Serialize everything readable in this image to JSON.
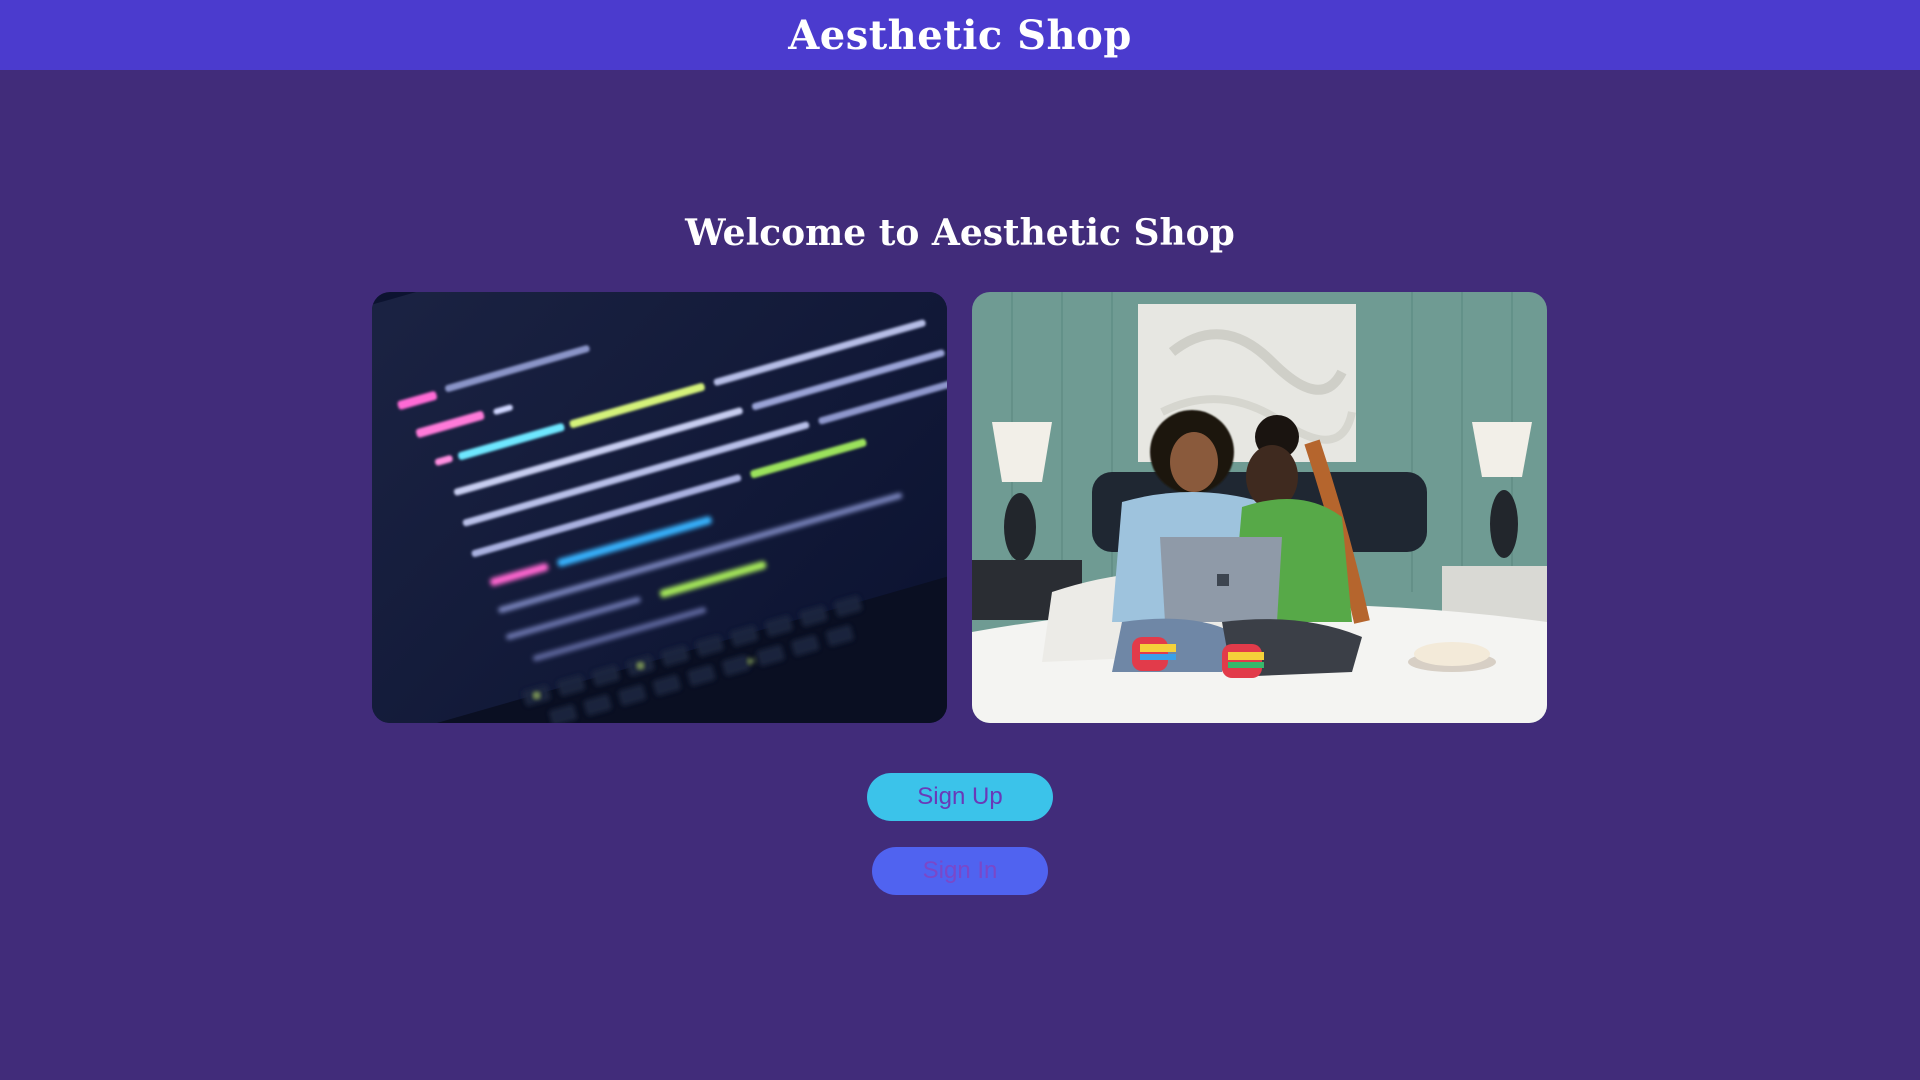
{
  "header": {
    "title": "Aesthetic Shop"
  },
  "main": {
    "welcome": "Welcome to Aesthetic Shop",
    "images": [
      {
        "subject": "code-on-laptop-screen"
      },
      {
        "subject": "two-people-with-laptop-on-bed"
      }
    ],
    "buttons": {
      "signup_label": "Sign Up",
      "signin_label": "Sign In"
    }
  },
  "colors": {
    "background": "#412c7a",
    "header": "#4b3bce",
    "signup_button": "#3bc3ea",
    "signin_button": "#5063f0"
  }
}
